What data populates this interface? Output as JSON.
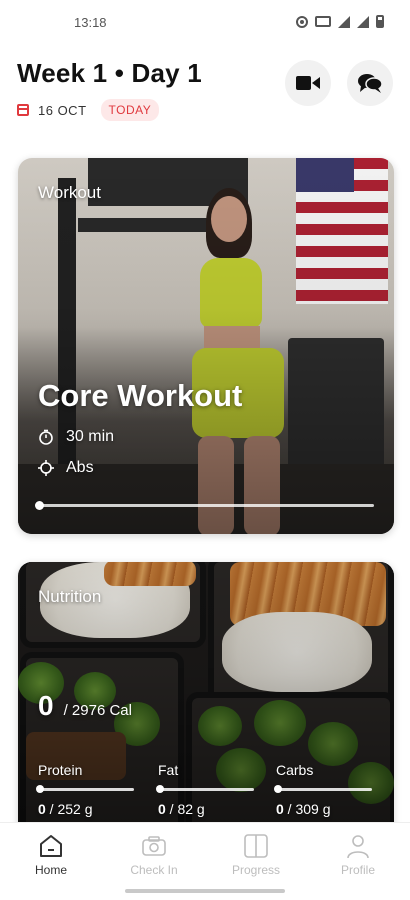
{
  "status_bar": {
    "time": "13:18"
  },
  "header": {
    "title": "Week 1 • Day 1",
    "date": "16 OCT",
    "today_badge": "TODAY"
  },
  "workout_card": {
    "label": "Workout",
    "title": "Core Workout",
    "duration": "30 min",
    "focus": "Abs",
    "progress": 0
  },
  "nutrition_card": {
    "label": "Nutrition",
    "calories_current": "0",
    "calories_goal": "/ 2976 Cal",
    "macros": [
      {
        "name": "Protein",
        "current": "0",
        "goal": " / 252 g",
        "progress": 0
      },
      {
        "name": "Fat",
        "current": "0",
        "goal": " / 82 g",
        "progress": 0
      },
      {
        "name": "Carbs",
        "current": "0",
        "goal": " / 309 g",
        "progress": 0
      }
    ]
  },
  "bottom_nav": {
    "items": [
      {
        "label": "Home",
        "icon": "home-icon",
        "active": true
      },
      {
        "label": "Check In",
        "icon": "camera-icon",
        "active": false
      },
      {
        "label": "Progress",
        "icon": "book-icon",
        "active": false
      },
      {
        "label": "Profile",
        "icon": "person-icon",
        "active": false
      }
    ]
  },
  "colors": {
    "accent": "#e0393e",
    "badge_bg": "#fde8e8",
    "nav_inactive": "#bdbdbd",
    "nav_active": "#333333"
  }
}
